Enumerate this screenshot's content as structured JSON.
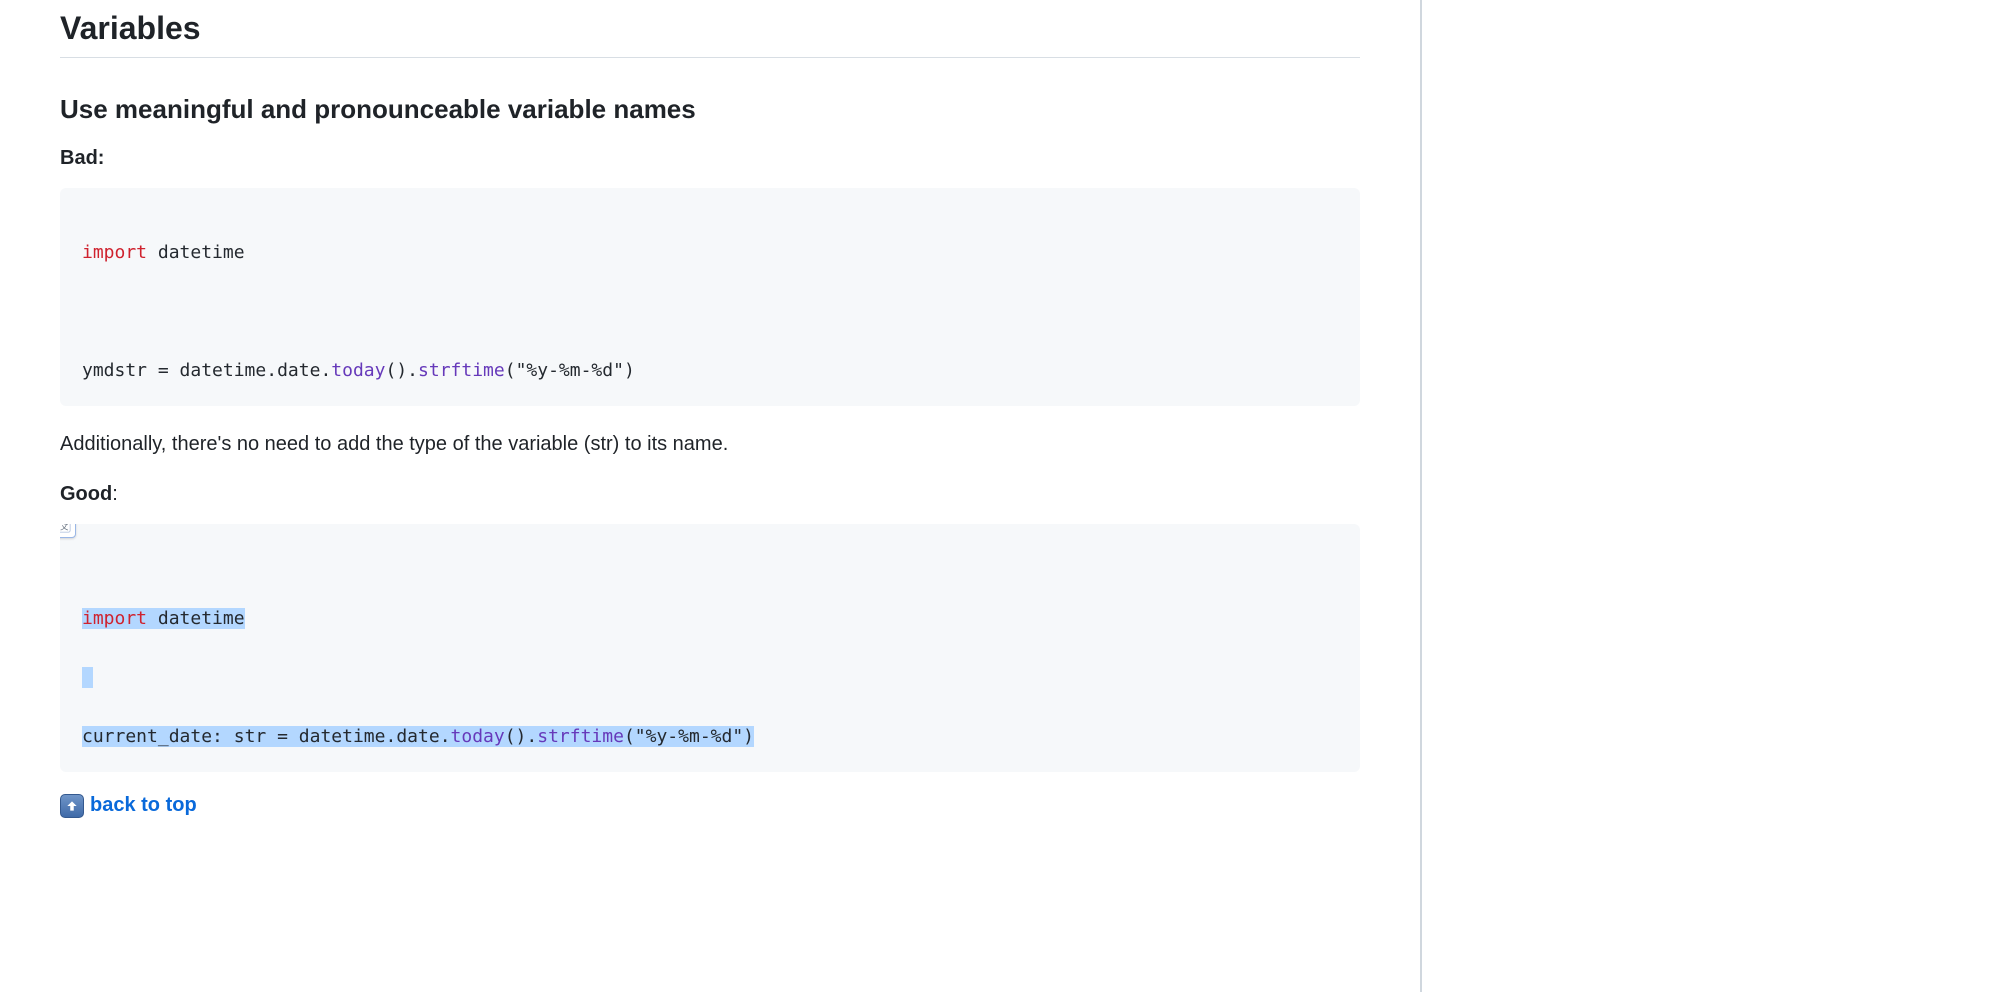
{
  "section": {
    "title": "Variables",
    "subsection": "Use meaningful and pronounceable variable names",
    "bad_label": "Bad:",
    "good_label_bold": "Good",
    "good_label_colon": ":",
    "note": "Additionally, there's no need to add the type of the variable (str) to its name.",
    "back_to_top": "back to top"
  },
  "code_bad": {
    "l1_kw": "import",
    "l1_rest": " datetime",
    "l3_a": "ymdstr ",
    "l3_eq": "=",
    "l3_b": " datetime",
    "l3_dot1": ".",
    "l3_c": "date",
    "l3_dot2": ".",
    "l3_fn1": "today",
    "l3_paren1": "()",
    "l3_dot3": ".",
    "l3_fn2": "strftime",
    "l3_paren2o": "(",
    "l3_str": "\"%y-%m-%d\"",
    "l3_paren2c": ")"
  },
  "code_good": {
    "l1_kw": "import",
    "l1_rest": " datetime",
    "l3_a": "current_date",
    "l3_colon": ": ",
    "l3_type": "str",
    "l3_sp": " ",
    "l3_eq": "=",
    "l3_b": " datetime",
    "l3_dot1": ".",
    "l3_c": "date",
    "l3_dot2": ".",
    "l3_fn1": "today",
    "l3_paren1": "()",
    "l3_dot3": ".",
    "l3_fn2": "strftime",
    "l3_paren2o": "(",
    "l3_str": "\"%y-%m-%d\"",
    "l3_paren2c": ")"
  }
}
